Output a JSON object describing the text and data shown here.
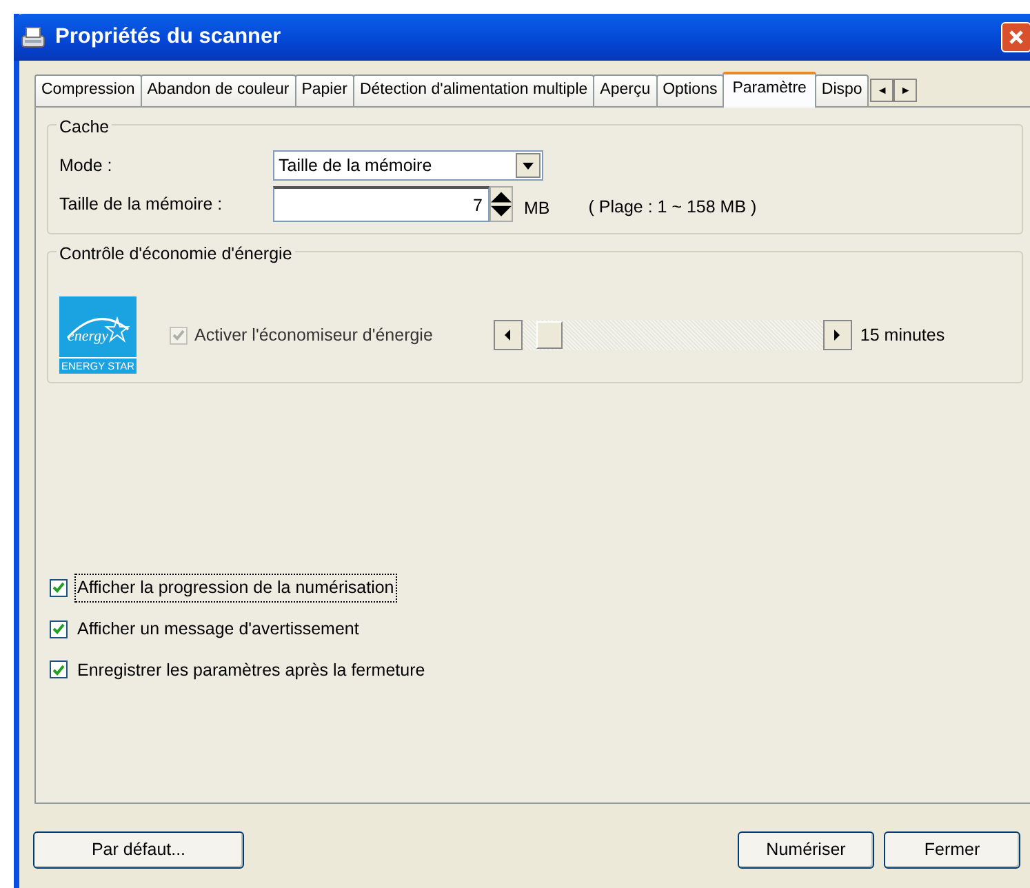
{
  "window": {
    "title": "Propriétés du scanner"
  },
  "tabs": [
    {
      "label": "Compression",
      "selected": false
    },
    {
      "label": "Abandon de couleur",
      "selected": false
    },
    {
      "label": "Papier",
      "selected": false
    },
    {
      "label": "Détection d'alimentation multiple",
      "selected": false
    },
    {
      "label": "Aperçu",
      "selected": false
    },
    {
      "label": "Options",
      "selected": false
    },
    {
      "label": "Paramètre",
      "selected": true
    },
    {
      "label": "Dispo",
      "selected": false
    }
  ],
  "tab_scroll": [
    "◄",
    "►"
  ],
  "cache": {
    "legend": "Cache",
    "mode_label": "Mode :",
    "mode_value": "Taille de la mémoire",
    "size_label": "Taille de la mémoire :",
    "size_value": "7",
    "unit": "MB",
    "range": "( Plage : 1 ~ 158 MB )"
  },
  "energy": {
    "legend": "Contrôle d'économie d'énergie",
    "logo_script": "energy",
    "logo_text": "ENERGY STAR",
    "checkbox": {
      "label": "Activer l'économiseur d'énergie",
      "checked": true,
      "disabled": true
    },
    "slider": {
      "level": 0.05
    },
    "reading": "15 minutes"
  },
  "options": [
    {
      "label": "Afficher la progression de la numérisation",
      "checked": true,
      "focused": true
    },
    {
      "label": "Afficher un message d'avertissement",
      "checked": true,
      "focused": false
    },
    {
      "label": "Enregistrer les paramètres après la fermeture",
      "checked": true,
      "focused": false
    }
  ],
  "buttons_left": [
    "Par défaut..."
  ],
  "buttons_right": [
    "Numériser",
    "Fermer"
  ]
}
